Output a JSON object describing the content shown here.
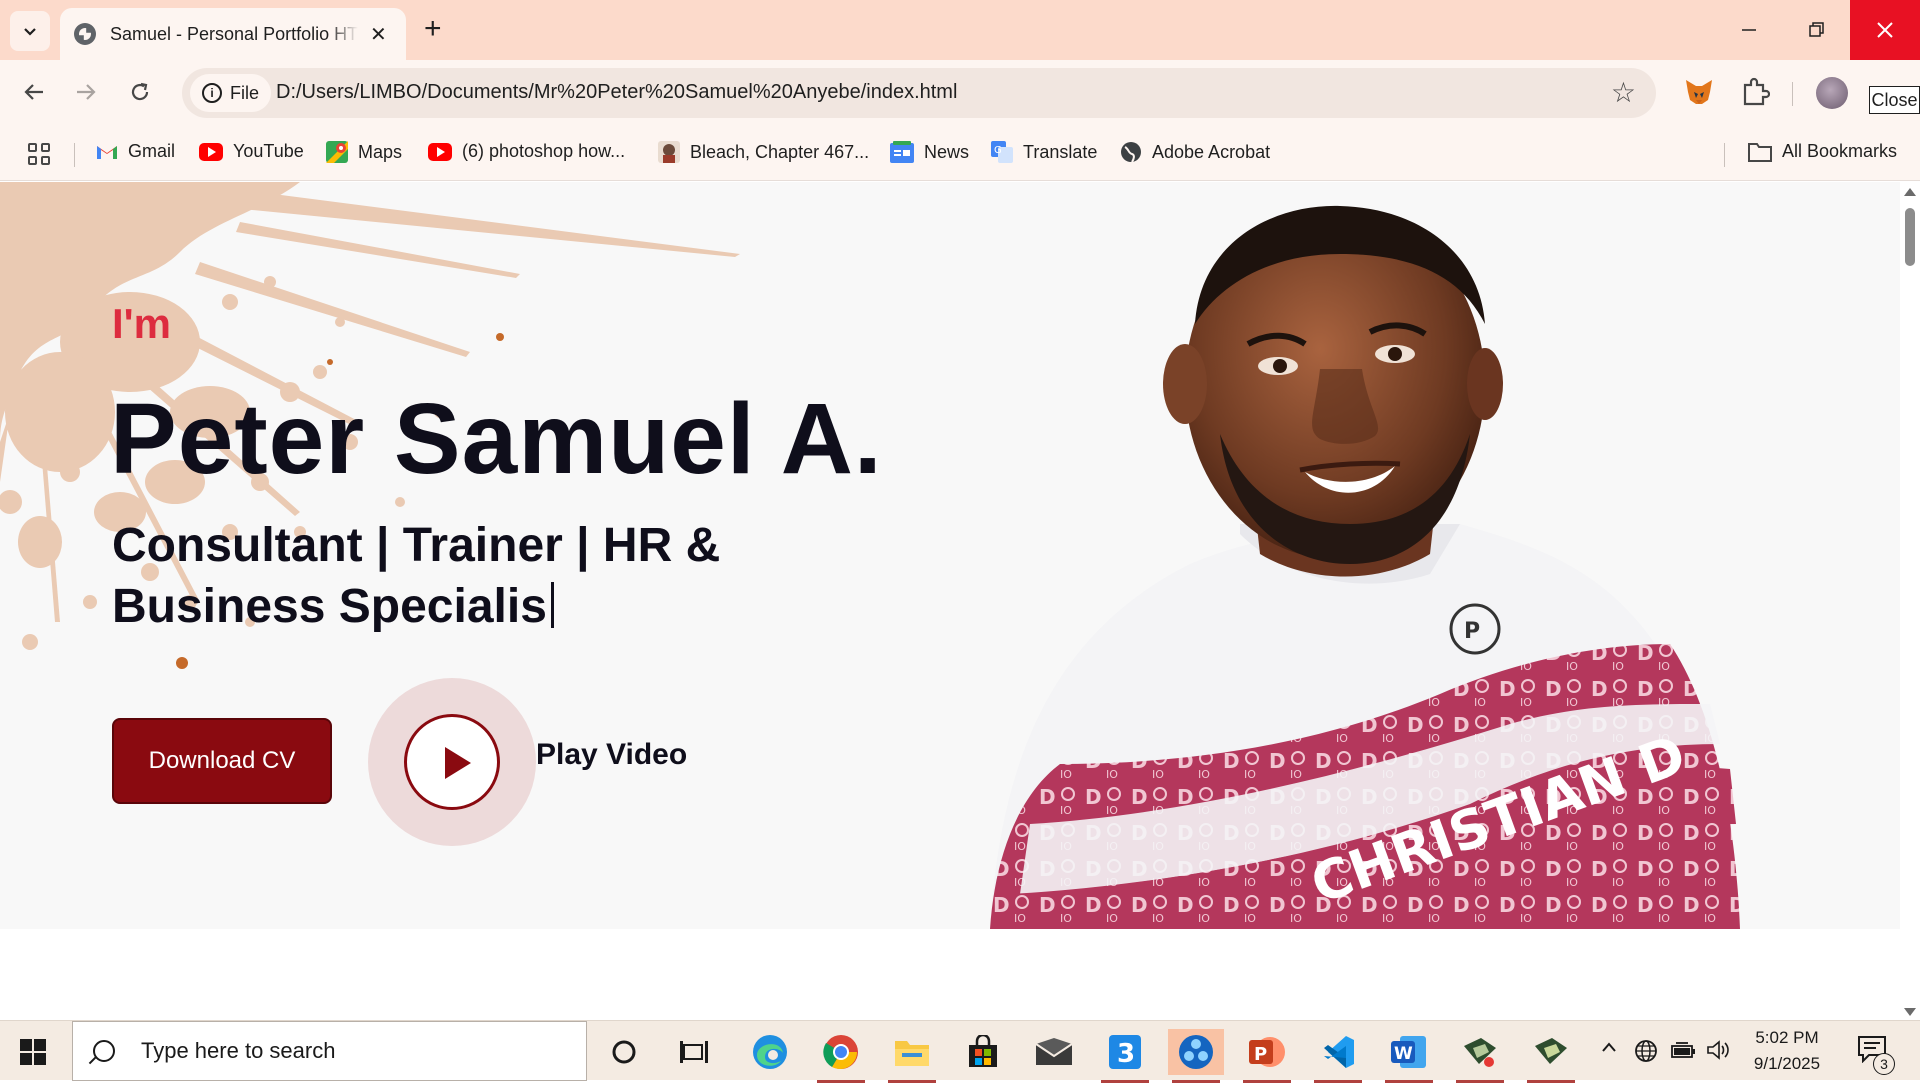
{
  "browser": {
    "tab_title": "Samuel - Personal Portfolio HTML",
    "address_chip": "File",
    "url": "D:/Users/LIMBO/Documents/Mr%20Peter%20Samuel%20Anyebe/index.html",
    "close_tooltip": "Close",
    "bookmarks": [
      {
        "label": "Gmail",
        "icon": "gmail-icon",
        "color": "#ea4335"
      },
      {
        "label": "YouTube",
        "icon": "youtube-icon",
        "color": "#ff0000"
      },
      {
        "label": "Maps",
        "icon": "maps-icon",
        "color": "#34a853"
      },
      {
        "label": "(6) photoshop how...",
        "icon": "youtube-icon",
        "color": "#ff0000"
      },
      {
        "label": "Bleach, Chapter 467...",
        "icon": "manga-icon",
        "color": "#6b4a3a"
      },
      {
        "label": "News",
        "icon": "news-icon",
        "color": "#4285f4"
      },
      {
        "label": "Translate",
        "icon": "translate-icon",
        "color": "#4285f4"
      },
      {
        "label": "Adobe Acrobat",
        "icon": "globe-icon",
        "color": "#3c4043"
      }
    ],
    "all_bookmarks": "All Bookmarks"
  },
  "hero": {
    "intro": "I'm",
    "name": "Peter Samuel A.",
    "role": "Consultant | Trainer | HR & Business Specialis",
    "download_button": "Download CV",
    "play_label": "Play Video",
    "accent_color": "#dd2c3f",
    "button_color": "#8a0a10"
  },
  "taskbar": {
    "search_placeholder": "Type here to search",
    "time": "5:02 PM",
    "date": "9/1/2025",
    "notification_count": "3"
  }
}
